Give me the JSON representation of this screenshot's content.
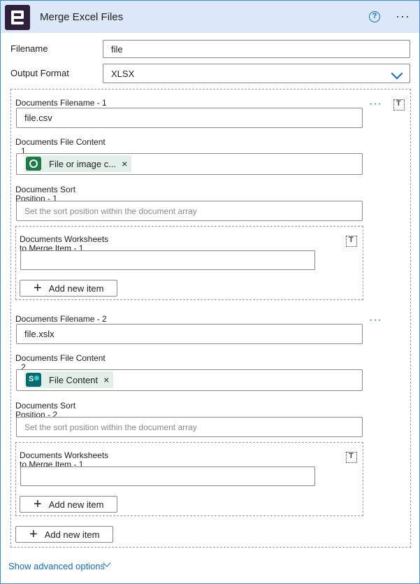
{
  "header": {
    "title": "Merge Excel Files",
    "help_glyph": "?",
    "more_glyph": "···"
  },
  "filename": {
    "label": "Filename",
    "value": "file"
  },
  "output_format": {
    "label": "Output Format",
    "value": "XLSX"
  },
  "documents": [
    {
      "filename_label": "Documents Filename - 1",
      "filename_value": "file.csv",
      "content_label": "Documents File Content",
      "content_label_suffix": "1",
      "content_token": "File or image c...",
      "content_token_icon": "dataverse-icon",
      "sort_label": "Documents Sort",
      "sort_label_suffix": "Position - 1",
      "sort_placeholder": "Set the sort position within the document array",
      "worksheets_label": "Documents Worksheets",
      "worksheets_label_suffix": "to Merge Item - 1",
      "worksheets_value": "",
      "add_item_label": "Add new item"
    },
    {
      "filename_label": "Documents Filename - 2",
      "filename_value": "file.xslx",
      "content_label": "Documents File Content",
      "content_label_suffix": "2",
      "content_token": "File Content",
      "content_token_icon": "sharepoint-icon",
      "sort_label": "Documents Sort",
      "sort_label_suffix": "Position - 2",
      "sort_placeholder": "Set the sort position within the document array",
      "worksheets_label": "Documents Worksheets",
      "worksheets_label_suffix": "to Merge Item - 1",
      "worksheets_value": "",
      "add_item_label": "Add new item"
    }
  ],
  "add_document_label": "Add new item",
  "show_advanced_label": "Show advanced options",
  "colors": {
    "accent": "#0f6cbd",
    "header_bg": "#dce8f7",
    "app_icon_bg": "#2e1f3d"
  }
}
